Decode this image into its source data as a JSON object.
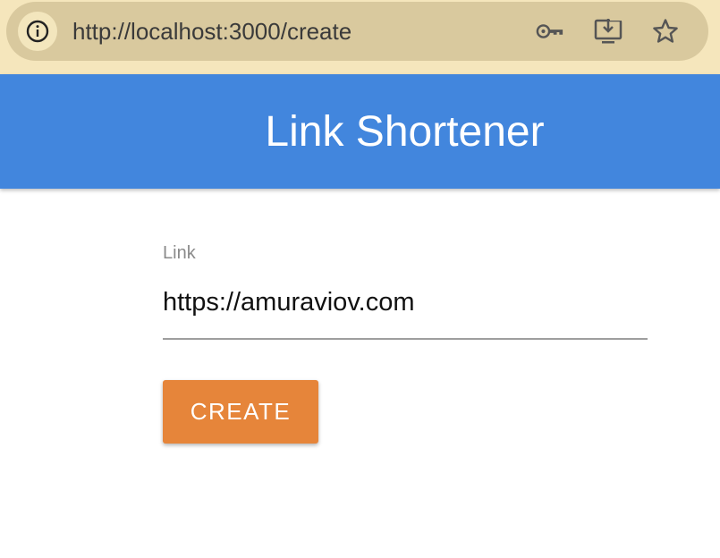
{
  "browser": {
    "url": "http://localhost:3000/create",
    "icons": {
      "site_info": "info-icon",
      "passwords": "key-icon",
      "install": "install-app-icon",
      "bookmark": "star-icon"
    }
  },
  "app": {
    "title": "Link Shortener",
    "colors": {
      "appbar": "#4286dd",
      "button": "#e6853a",
      "chrome": "#f5e6bc",
      "omnibox": "#d9c99e"
    }
  },
  "form": {
    "link_label": "Link",
    "link_value": "https://amuraviov.com",
    "create_label": "CREATE"
  }
}
